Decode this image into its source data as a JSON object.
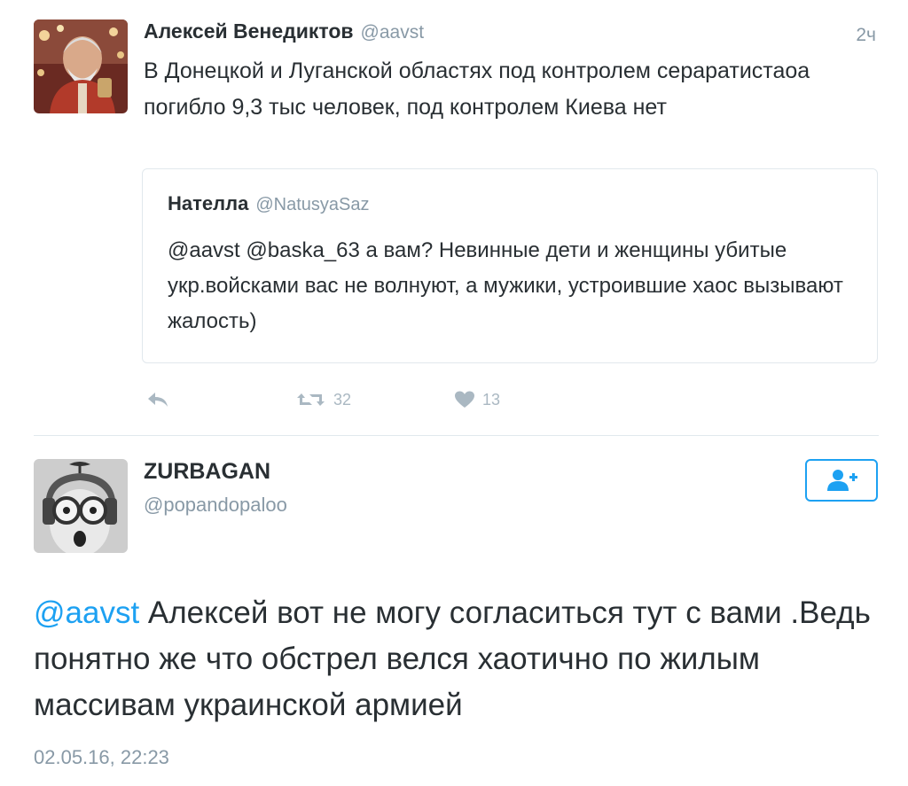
{
  "tweet1": {
    "author_name": "Алексей Венедиктов",
    "author_handle": "@aavst",
    "time": "2ч",
    "text": "В Донецкой и Луганской областях под контролем сераратистаоа погибло 9,3 тыс человек, под контролем Киева нет",
    "quote": {
      "author_name": "Нателла",
      "author_handle": "@NatusyaSaz",
      "text": "@aavst @baska_63 а вам? Невинные дети и женщины убитые укр.войсками вас не волнуют, а мужики, устроившие хаос вызывают жалость)"
    },
    "actions": {
      "reply_icon": "reply-icon",
      "retweet_icon": "retweet-icon",
      "retweet_count": "32",
      "like_icon": "heart-icon",
      "like_count": "13"
    }
  },
  "tweet2": {
    "author_name": "ZURBAGAN",
    "author_handle": "@popandopaloo",
    "follow_icon": "add-user-icon",
    "mention": "@aavst",
    "text": " Алексей вот не могу согласиться тут с вами .Ведь понятно же что обстрел велся хаотично по жилым массивам украинской армией",
    "date": "02.05.16, 22:23"
  },
  "colors": {
    "accent": "#1da1f2",
    "text": "#292f33",
    "secondary": "#8899a6",
    "icon": "#aab8c2",
    "border": "#e1e8ed"
  }
}
